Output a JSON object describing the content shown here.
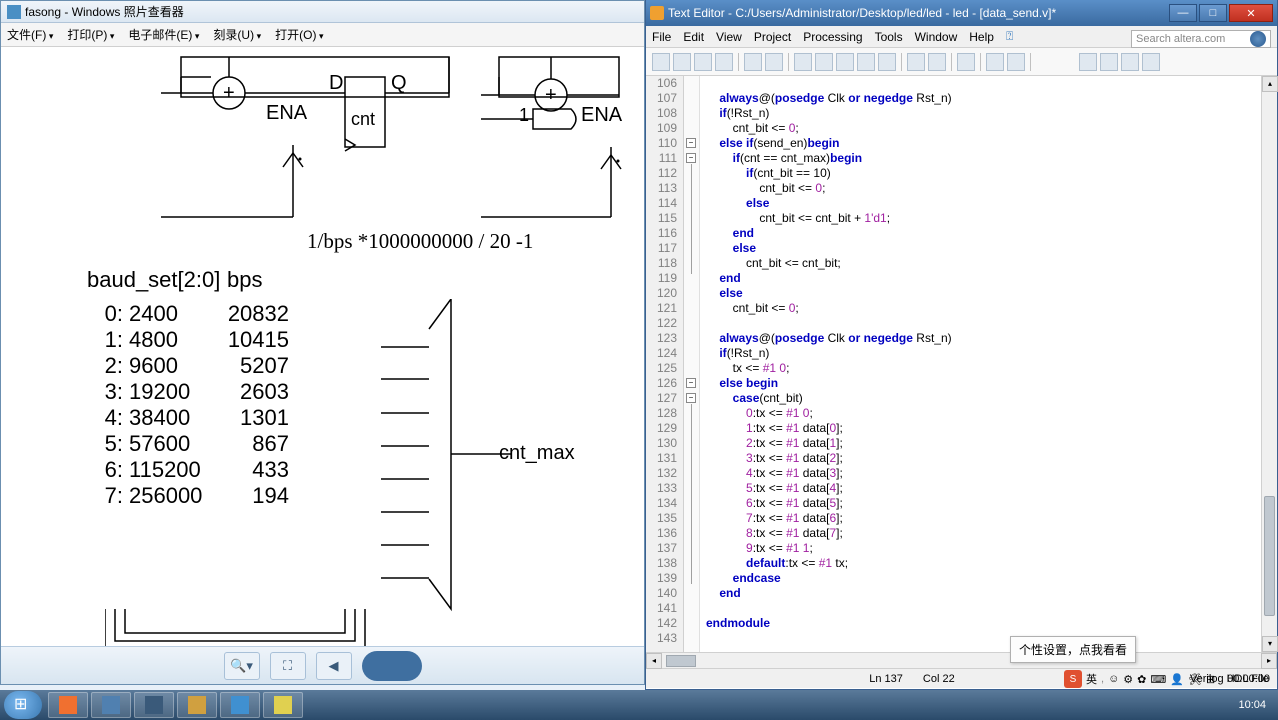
{
  "photo_viewer": {
    "title": "fasong - Windows 照片查看器",
    "menu": [
      "文件(F)",
      "打印(P)",
      "电子邮件(E)",
      "刻录(U)",
      "打开(O)"
    ],
    "formula": "1/bps *1000000000  / 20 -1",
    "baud_header": {
      "label": "baud_set[2:0]",
      "bps": "bps"
    },
    "diagram_labels": {
      "D": "D",
      "Q": "Q",
      "ENA1": "ENA",
      "ENA2": "ENA",
      "one": "1",
      "cnt": "cnt",
      "cnt_max": "cnt_max"
    },
    "baud_rows": [
      {
        "idx": "0:",
        "bps": "2400",
        "val": "20832"
      },
      {
        "idx": "1:",
        "bps": "4800",
        "val": "10415"
      },
      {
        "idx": "2:",
        "bps": "9600",
        "val": "5207"
      },
      {
        "idx": "3:",
        "bps": "19200",
        "val": "2603"
      },
      {
        "idx": "4:",
        "bps": "38400",
        "val": "1301"
      },
      {
        "idx": "5:",
        "bps": "57600",
        "val": "867"
      },
      {
        "idx": "6:",
        "bps": "115200",
        "val": "433"
      },
      {
        "idx": "7:",
        "bps": "256000",
        "val": "194"
      }
    ]
  },
  "text_editor": {
    "title": "Text Editor - C:/Users/Administrator/Desktop/led/led - led - [data_send.v]*",
    "menu": [
      "File",
      "Edit",
      "View",
      "Project",
      "Processing",
      "Tools",
      "Window",
      "Help"
    ],
    "search_placeholder": "Search altera.com",
    "lines_start": 106,
    "code_lines": [
      "",
      "    always@(posedge Clk or negedge Rst_n)",
      "    if(!Rst_n)",
      "        cnt_bit <= 0;",
      "    else if(send_en)begin",
      "        if(cnt == cnt_max)begin",
      "            if(cnt_bit == 10)",
      "                cnt_bit <= 0;",
      "            else",
      "                cnt_bit <= cnt_bit + 1'd1;",
      "        end",
      "        else",
      "            cnt_bit <= cnt_bit;",
      "    end",
      "    else",
      "        cnt_bit <= 0;",
      "",
      "    always@(posedge Clk or negedge Rst_n)",
      "    if(!Rst_n)",
      "        tx <= #1 0;",
      "    else begin",
      "        case(cnt_bit)",
      "            0:tx <= #1 0;",
      "            1:tx <= #1 data[0];",
      "            2:tx <= #1 data[1];",
      "            3:tx <= #1 data[2];",
      "            4:tx <= #1 data[3];",
      "            5:tx <= #1 data[4];",
      "            6:tx <= #1 data[5];",
      "            7:tx <= #1 data[6];",
      "            8:tx <= #1 data[7];",
      "            9:tx <= #1 1;",
      "            default:tx <= #1 tx;",
      "        endcase",
      "    end",
      "",
      "endmodule",
      ""
    ],
    "status": {
      "ln": "Ln 137",
      "col": "Col 22",
      "filetype": "Verilog HDL File"
    },
    "tooltip": "个性设置，点我看看"
  },
  "ime": {
    "timer": "00:00:00",
    "lang": "英"
  },
  "taskbar": {
    "clock": "10:04"
  }
}
